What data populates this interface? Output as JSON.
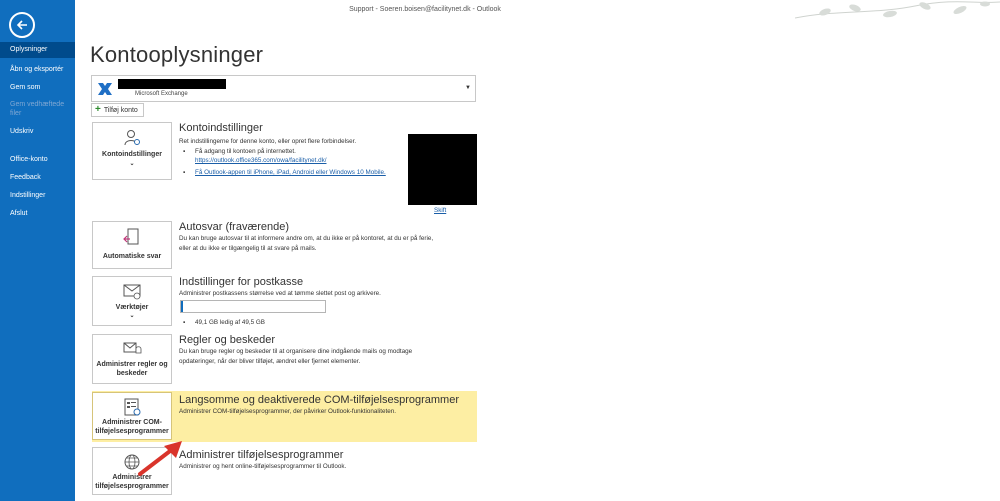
{
  "window": {
    "title": "Support - Soeren.boisen@facilitynet.dk  -  Outlook"
  },
  "sidebar": {
    "items": [
      {
        "label": "Oplysninger",
        "active": true
      },
      {
        "label": "Åbn og eksportér"
      },
      {
        "label": "Gem som"
      },
      {
        "label": "Gem vedhæftede filer",
        "disabled": true
      },
      {
        "label": "Udskriv"
      },
      {
        "label": "Office-konto"
      },
      {
        "label": "Feedback"
      },
      {
        "label": "Indstillinger"
      },
      {
        "label": "Afslut"
      }
    ]
  },
  "page": {
    "title": "Kontooplysninger"
  },
  "account": {
    "type": "Microsoft Exchange",
    "add_label": "Tilføj konto"
  },
  "sections": {
    "account_settings": {
      "tile_label": "Kontoindstillinger",
      "title": "Kontoindstillinger",
      "desc": "Ret indstillingerne for denne konto, eller opret flere forbindelser.",
      "bullet1": "Få adgang til kontoen på internettet.",
      "link1": "https://outlook.office365.com/owa/facilitynet.dk/",
      "link2": "Få Outlook-appen til iPhone, iPad, Android eller Windows 10 Mobile.",
      "change_link": "Skift"
    },
    "auto_reply": {
      "tile_label": "Automatiske svar",
      "title": "Autosvar (fraværende)",
      "desc1": "Du kan bruge autosvar til at informere andre om, at du ikke er på kontoret, at du er på ferie,",
      "desc2": "eller at du ikke er tilgængelig til at svare på mails."
    },
    "mailbox": {
      "tile_label": "Værktøjer",
      "title": "Indstillinger for postkasse",
      "desc": "Administrer postkassens størrelse ved at tømme slettet post og arkivere.",
      "storage_text": "49,1 GB ledig af 49,5 GB",
      "storage_used_fraction": 0.01
    },
    "rules": {
      "tile_label": "Administrer regler og beskeder",
      "title": "Regler og beskeder",
      "desc1": "Du kan bruge regler og beskeder til at organisere dine indgående mails og modtage",
      "desc2": "opdateringer, når der bliver tilføjet, ændret eller fjernet elementer."
    },
    "com_addins": {
      "tile_label": "Administrer COM-tilføjelsesprogrammer",
      "title": "Langsomme og deaktiverede COM-tilføjelsesprogrammer",
      "desc": "Administrer COM-tilføjelsesprogrammer, der påvirker Outlook-funktionaliteten."
    },
    "addins": {
      "tile_label": "Administrer tilføjelsesprogrammer",
      "title": "Administrer tilføjelsesprogrammer",
      "desc": "Administrer og hent online-tilføjelsesprogrammer til Outlook."
    }
  },
  "colors": {
    "sidebar": "#106ebe",
    "sidebar_active": "#004b8c",
    "highlight": "#fdeea3",
    "link": "#1a5ea8",
    "arrow": "#d9342b"
  }
}
